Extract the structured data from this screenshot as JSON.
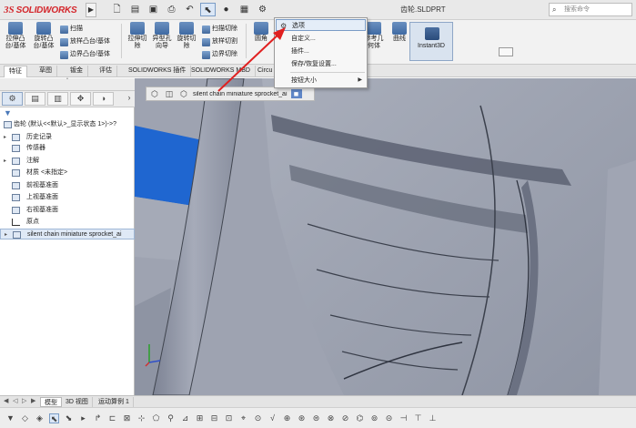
{
  "titlebar": {
    "logo_ds": "3S",
    "logo_text": "SOLIDWORKS",
    "doc_title": "齿轮.SLDPRT",
    "search_placeholder": "搜索命令"
  },
  "ribbon": {
    "big_buttons": [
      {
        "label": "拉伸凸\n台/基体"
      },
      {
        "label": "旋转凸\n台/基体"
      },
      {
        "label": "拉伸切\n除"
      },
      {
        "label": "异型孔\n向导"
      },
      {
        "label": "旋转切\n除"
      },
      {
        "label": "圆角"
      }
    ],
    "small_buttons": [
      {
        "label": "扫描"
      },
      {
        "label": "放样凸台/基体"
      },
      {
        "label": "边界凸台/基体"
      },
      {
        "label": "扫描切除"
      },
      {
        "label": "放样切割"
      },
      {
        "label": "边界切除"
      }
    ],
    "right_buttons": [
      {
        "label": "参考几\n何体"
      },
      {
        "label": "曲线"
      }
    ],
    "instant3d": "Instant3D"
  },
  "tabs": [
    "特征",
    "草图",
    "钣金",
    "评估",
    "SOLIDWORKS 插件",
    "SOLIDWORKS MBD",
    "Circu"
  ],
  "menu": {
    "items": [
      {
        "label": "选项",
        "highlighted": true,
        "has_gear": true
      },
      {
        "label": "自定义..."
      },
      {
        "label": "插件..."
      },
      {
        "label": "保存/恢复设置..."
      },
      {
        "label": "按钮大小",
        "has_submenu": true
      }
    ]
  },
  "tree": {
    "root": "齿轮  (默认<<默认>_显示状态 1>)->?",
    "items": [
      {
        "label": "历史记录",
        "expandable": true
      },
      {
        "label": "传感器",
        "expandable": false
      },
      {
        "label": "注解",
        "expandable": true
      },
      {
        "label": "材质 <未指定>",
        "expandable": false
      },
      {
        "label": "前视基准面",
        "expandable": false
      },
      {
        "label": "上视基准面",
        "expandable": false
      },
      {
        "label": "右视基准面",
        "expandable": false
      },
      {
        "label": "原点",
        "expandable": false
      },
      {
        "label": "silent chain miniature sprocket_ai",
        "expandable": true,
        "selected": true
      }
    ]
  },
  "viewport": {
    "breadcrumb_label": "silent chain miniature sprocket_ai"
  },
  "bottom_tabs": [
    "模型",
    "3D 视图",
    "运动算例 1"
  ],
  "icons": {
    "gear": "gear-icon",
    "search": "search-icon",
    "filter": "filter-icon",
    "arrow": "annotation-arrow"
  },
  "colors": {
    "accent_blue": "#1e63c9",
    "annotation_red": "#e02020",
    "model_gray": "#9aa0b0",
    "brand_red": "#d4262b"
  }
}
